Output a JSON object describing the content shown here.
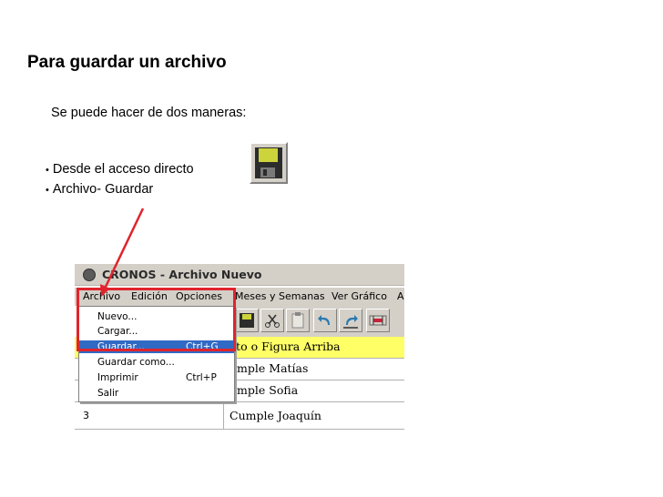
{
  "slide": {
    "title": "Para guardar un archivo",
    "intro": "Se puede hacer de dos maneras:",
    "bullets": [
      "Desde el acceso directo",
      "Archivo- Guardar"
    ],
    "bullet_glyph": "•",
    "save_icon": "floppy-disk-icon"
  },
  "app": {
    "title": "CRONOS - Archivo Nuevo",
    "menu": [
      "Archivo",
      "Edición",
      "Opciones",
      "Meses y Semanas",
      "Ver Gráfico",
      "A"
    ],
    "file_menu": [
      {
        "label": "Nuevo...",
        "shortcut": ""
      },
      {
        "label": "Cargar...",
        "shortcut": ""
      },
      {
        "label": "Guardar...",
        "shortcut": "Ctrl+G"
      },
      {
        "label": "Guardar como...",
        "shortcut": ""
      },
      {
        "label": "Imprimir",
        "shortcut": "Ctrl+P"
      },
      {
        "label": "Salir",
        "shortcut": ""
      }
    ],
    "highlighted_item": "Guardar...",
    "toolbar_icons": [
      "save-icon",
      "cut-icon",
      "paste-icon",
      "undo-icon",
      "redo-icon",
      "range-icon"
    ],
    "grid": {
      "header": "xto o Figura Arriba",
      "rows": [
        {
          "num": "",
          "text": "umple Matías"
        },
        {
          "num": "",
          "text": "umple Sofia"
        },
        {
          "num": "3",
          "text": "Cumple Joaquín"
        }
      ]
    }
  },
  "colors": {
    "highlight_red": "#e0242c",
    "menu_highlight": "#316ac5",
    "grid_header": "#ffff66",
    "window_chrome": "#d4d0c8"
  }
}
